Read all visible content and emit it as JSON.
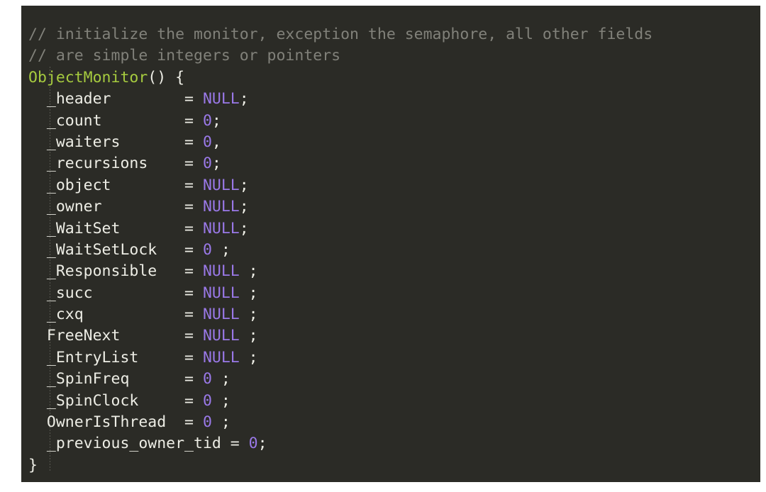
{
  "editor": {
    "background_color": "#2B2B26",
    "page_background_color": "#FFFFFF",
    "language": "cpp",
    "font_family_style": "monospace",
    "colors": {
      "comment": "#81817A",
      "function_name": "#A6CB3F",
      "plain_text": "#EDEDE5",
      "constant": "#9A79E8",
      "punctuation": "#EDEDE5"
    }
  },
  "code": {
    "lines": [
      {
        "id": "line-1",
        "kind": "comment",
        "tokens": [
          {
            "type": "comment",
            "text": "// initialize the monitor, exception the semaphore, all other fields"
          }
        ]
      },
      {
        "id": "line-2",
        "kind": "comment",
        "tokens": [
          {
            "type": "comment",
            "text": "// are simple integers or pointers"
          }
        ]
      },
      {
        "id": "line-3",
        "kind": "signature",
        "tokens": [
          {
            "type": "function_name",
            "text": "ObjectMonitor"
          },
          {
            "type": "punctuation",
            "text": "() {"
          }
        ]
      },
      {
        "id": "line-4",
        "kind": "assignment",
        "tokens": [
          {
            "type": "plain",
            "text": "  _header        = "
          },
          {
            "type": "constant",
            "text": "NULL"
          },
          {
            "type": "punctuation",
            "text": ";"
          }
        ]
      },
      {
        "id": "line-5",
        "kind": "assignment",
        "tokens": [
          {
            "type": "plain",
            "text": "  _count         = "
          },
          {
            "type": "constant",
            "text": "0"
          },
          {
            "type": "punctuation",
            "text": ";"
          }
        ]
      },
      {
        "id": "line-6",
        "kind": "assignment",
        "tokens": [
          {
            "type": "plain",
            "text": "  _waiters       = "
          },
          {
            "type": "constant",
            "text": "0"
          },
          {
            "type": "punctuation",
            "text": ","
          }
        ]
      },
      {
        "id": "line-7",
        "kind": "assignment",
        "tokens": [
          {
            "type": "plain",
            "text": "  _recursions    = "
          },
          {
            "type": "constant",
            "text": "0"
          },
          {
            "type": "punctuation",
            "text": ";"
          }
        ]
      },
      {
        "id": "line-8",
        "kind": "assignment",
        "tokens": [
          {
            "type": "plain",
            "text": "  _object        = "
          },
          {
            "type": "constant",
            "text": "NULL"
          },
          {
            "type": "punctuation",
            "text": ";"
          }
        ]
      },
      {
        "id": "line-9",
        "kind": "assignment",
        "tokens": [
          {
            "type": "plain",
            "text": "  _owner         = "
          },
          {
            "type": "constant",
            "text": "NULL"
          },
          {
            "type": "punctuation",
            "text": ";"
          }
        ]
      },
      {
        "id": "line-10",
        "kind": "assignment",
        "tokens": [
          {
            "type": "plain",
            "text": "  _WaitSet       = "
          },
          {
            "type": "constant",
            "text": "NULL"
          },
          {
            "type": "punctuation",
            "text": ";"
          }
        ]
      },
      {
        "id": "line-11",
        "kind": "assignment",
        "tokens": [
          {
            "type": "plain",
            "text": "  _WaitSetLock   = "
          },
          {
            "type": "constant",
            "text": "0"
          },
          {
            "type": "punctuation",
            "text": " ;"
          }
        ]
      },
      {
        "id": "line-12",
        "kind": "assignment",
        "tokens": [
          {
            "type": "plain",
            "text": "  _Responsible   = "
          },
          {
            "type": "constant",
            "text": "NULL"
          },
          {
            "type": "punctuation",
            "text": " ;"
          }
        ]
      },
      {
        "id": "line-13",
        "kind": "assignment",
        "tokens": [
          {
            "type": "plain",
            "text": "  _succ          = "
          },
          {
            "type": "constant",
            "text": "NULL"
          },
          {
            "type": "punctuation",
            "text": " ;"
          }
        ]
      },
      {
        "id": "line-14",
        "kind": "assignment",
        "tokens": [
          {
            "type": "plain",
            "text": "  _cxq           = "
          },
          {
            "type": "constant",
            "text": "NULL"
          },
          {
            "type": "punctuation",
            "text": " ;"
          }
        ]
      },
      {
        "id": "line-15",
        "kind": "assignment",
        "tokens": [
          {
            "type": "plain",
            "text": "  FreeNext       = "
          },
          {
            "type": "constant",
            "text": "NULL"
          },
          {
            "type": "punctuation",
            "text": " ;"
          }
        ]
      },
      {
        "id": "line-16",
        "kind": "assignment",
        "tokens": [
          {
            "type": "plain",
            "text": "  _EntryList     = "
          },
          {
            "type": "constant",
            "text": "NULL"
          },
          {
            "type": "punctuation",
            "text": " ;"
          }
        ]
      },
      {
        "id": "line-17",
        "kind": "assignment",
        "tokens": [
          {
            "type": "plain",
            "text": "  _SpinFreq      = "
          },
          {
            "type": "constant",
            "text": "0"
          },
          {
            "type": "punctuation",
            "text": " ;"
          }
        ]
      },
      {
        "id": "line-18",
        "kind": "assignment",
        "tokens": [
          {
            "type": "plain",
            "text": "  _SpinClock     = "
          },
          {
            "type": "constant",
            "text": "0"
          },
          {
            "type": "punctuation",
            "text": " ;"
          }
        ]
      },
      {
        "id": "line-19",
        "kind": "assignment",
        "tokens": [
          {
            "type": "plain",
            "text": "  OwnerIsThread  = "
          },
          {
            "type": "constant",
            "text": "0"
          },
          {
            "type": "punctuation",
            "text": " ;"
          }
        ]
      },
      {
        "id": "line-20",
        "kind": "assignment",
        "tokens": [
          {
            "type": "plain",
            "text": "  _previous_owner_tid = "
          },
          {
            "type": "constant",
            "text": "0"
          },
          {
            "type": "punctuation",
            "text": ";"
          }
        ]
      },
      {
        "id": "line-21",
        "kind": "closing",
        "tokens": [
          {
            "type": "punctuation",
            "text": "}"
          }
        ]
      }
    ]
  }
}
